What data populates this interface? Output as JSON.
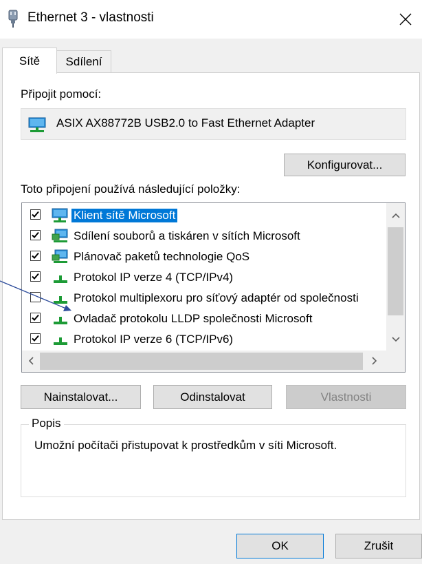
{
  "window": {
    "title": "Ethernet 3 - vlastnosti",
    "close_glyph": "✕"
  },
  "tabs": [
    {
      "label": "Sítě",
      "active": true
    },
    {
      "label": "Sdílení",
      "active": false
    }
  ],
  "connect_using": {
    "label": "Připojit pomocí:",
    "adapter_name": "ASIX AX88772B USB2.0 to Fast Ethernet Adapter",
    "configure_button": "Konfigurovat..."
  },
  "items_section": {
    "label": "Toto připojení používá následující položky:",
    "items": [
      {
        "label": "Klient sítě Microsoft",
        "checked": true,
        "icon": "network-client-icon",
        "selected": true
      },
      {
        "label": "Sdílení souborů a tiskáren v sítích Microsoft",
        "checked": true,
        "icon": "network-service-icon",
        "selected": false
      },
      {
        "label": "Plánovač paketů technologie QoS",
        "checked": true,
        "icon": "network-service-icon",
        "selected": false
      },
      {
        "label": "Protokol IP verze 4 (TCP/IPv4)",
        "checked": true,
        "icon": "protocol-icon",
        "selected": false
      },
      {
        "label": "Protokol multiplexoru pro síťový adaptér od společnosti",
        "checked": false,
        "icon": "protocol-icon",
        "selected": false
      },
      {
        "label": "Ovladač protokolu LLDP společnosti Microsoft",
        "checked": true,
        "icon": "protocol-icon",
        "selected": false
      },
      {
        "label": "Protokol IP verze 6 (TCP/IPv6)",
        "checked": true,
        "icon": "protocol-icon",
        "selected": false
      }
    ]
  },
  "action_buttons": {
    "install": "Nainstalovat...",
    "uninstall": "Odinstalovat",
    "properties": "Vlastnosti"
  },
  "description": {
    "legend": "Popis",
    "text": "Umožní počítači přistupovat k prostředkům v síti Microsoft."
  },
  "footer": {
    "ok": "OK",
    "cancel": "Zrušit"
  },
  "colors": {
    "selection": "#0078d7",
    "annotation": "#2e4d9c"
  }
}
